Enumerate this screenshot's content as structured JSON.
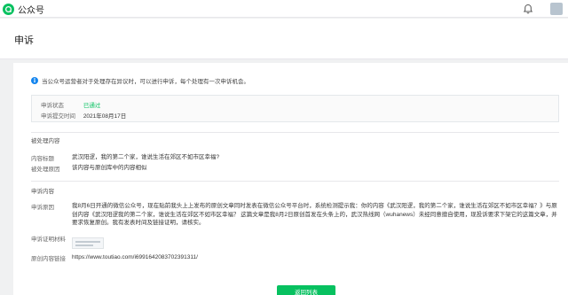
{
  "app": {
    "title": "公众号",
    "logo_icon": "wechat-official-account-logo-icon",
    "accent": "#07c160"
  },
  "header": {
    "bell_icon": "bell-icon"
  },
  "page": {
    "title": "申诉"
  },
  "notice": {
    "icon": "info-icon",
    "text": "当公众号运营者对于处理存在异议时，可以进行申诉，每个处理有一次申诉机会。"
  },
  "status": {
    "state_label": "申诉状态",
    "state_value": "已通过",
    "state_color": "#07c160",
    "time_label": "申诉提交时间",
    "time_value": "2021年08月17日"
  },
  "processed": {
    "section_title": "被处理内容",
    "title_label": "内容标题",
    "title_value": "武汉阳逻，我的第二个家，谁说生活在郊区不如市区幸福?",
    "reason_label": "被处理原因",
    "reason_value": "该内容与原创库中的内容相似"
  },
  "appeal": {
    "section_title": "申诉内容",
    "reason_label": "申诉原因",
    "reason_value": "我8月6日开通的微信公众号，现在贴前我头上上发布的原创文章同时发表在微信公众号平台时，系统检测提示我：你的内容《武汉阳逻，我的第二个家，谁说生活在郊区不如市区幸福？》与原创内容《武汉阳逻我的第二个家，谁说生活在郊区不如市区幸福？ 这篇文章是我8月2日原创首发在头条上的，武汉热线网（wuhanews）未经同意擅自使用，现投诉要求下架它的这篇文章，并要求恢复原创。我有发表时间及链接证明，请核实。",
    "proof_label": "申诉证明材料",
    "link_label": "原创内容链接",
    "link_value": "https://www.toutiao.com/i6991642083702391311/"
  },
  "actions": {
    "back_label": "返回列表"
  }
}
